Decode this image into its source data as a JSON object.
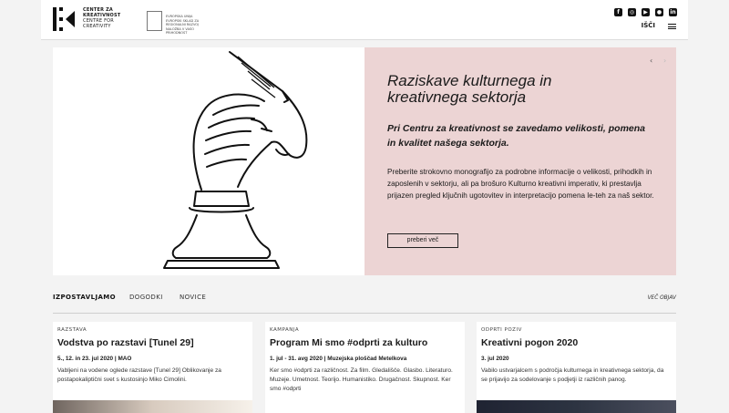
{
  "header": {
    "brand_line1": "CENTER ZA",
    "brand_line2": "KREATIVNOST",
    "brand_line3": "CENTRE FOR",
    "brand_line4": "CREATIVITY",
    "eu_line1": "EVROPSKA UNIJA",
    "eu_line2": "EVROPSKI SKLAD ZA",
    "eu_line3": "REGIONALNI RAZVOJ",
    "eu_line4": "NALOŽBA V VAŠO PRIHODNOST",
    "search_label": "IŠČI",
    "social_icons": [
      "facebook-icon",
      "instagram-icon",
      "youtube-icon",
      "flickr-icon",
      "linkedin-icon"
    ]
  },
  "hero": {
    "title": "Raziskave kulturnega in kreativnega sektorja",
    "subtitle": "Pri Centru za kreativnost se zavedamo velikosti, pomena in kvalitet našega sektorja.",
    "description": "Preberite strokovno monografijo za podrobne informacije o velikosti, prihodkih in zaposlenih v sektorju, ali pa brošuro Kulturno kreativni imperativ, ki prestavlja prijazen pregled ključnih ugotovitev in interpretacijo pomena le-teh za naš sektor.",
    "button": "preberi več",
    "prev_arrow": "‹",
    "next_arrow": "›"
  },
  "tabs": {
    "items": [
      "IZPOSTAVLJAMO",
      "DOGODKI",
      "NOVICE"
    ],
    "more": "VEČ OBJAV"
  },
  "cards": [
    {
      "category": "RAZSTAVA",
      "title": "Vodstva po razstavi [Tunel 29]",
      "date": "5., 12. in 23. jul 2020 | MAO",
      "text": "Vabljeni na vodene oglede razstave [Tunel 29] Oblikovanje za postapokaliptični svet s kustosinjo Miko Cimolini."
    },
    {
      "category": "KAMPANJA",
      "title": "Program Mi smo #odprti za kulturo",
      "date": "1. jul - 31. avg 2020 | Muzejska ploščad Metelkova",
      "text": "Ker smo #odprti za različnost. Za film. Gledališče. Glasbo. Literaturo. Muzeje. Umetnost. Teorijo. Humanistiko. Drugačnost. Skupnost. Ker smo #odprti"
    },
    {
      "category": "ODPRTI POZIV",
      "title": "Kreativni pogon 2020",
      "date": "3. jul 2020",
      "text": "Vabilo ustvarjalcem s področja kulturnega in kreativnega sektorja, da se prijavijo za sodelovanje s podjetji iz različnih panog."
    }
  ]
}
